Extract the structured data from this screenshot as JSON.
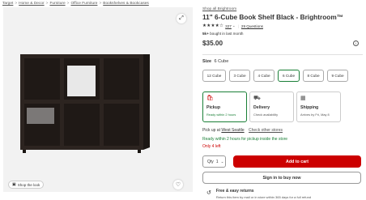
{
  "breadcrumb": [
    "Target",
    "Home & Decor",
    "Furniture",
    "Office Furniture",
    "Bookshelves & Bookcases"
  ],
  "breadcrumb_separator": ">",
  "image_panel": {
    "shop_the_look": "Shop the look"
  },
  "product": {
    "brand_link": "Shop all Brightroom",
    "title": "11\" 6-Cube Book Shelf Black - Brightroom™",
    "stars_filled": "★★★★",
    "stars_empty": "☆",
    "rating_count": "327",
    "questions": "29 Questions",
    "bought_bold": "5k+",
    "bought_text": "bought in last month",
    "price": "$35.00"
  },
  "size": {
    "label": "Size",
    "selected": "6 Cube",
    "options": [
      "12 Cube",
      "3 Cube",
      "4 Cube",
      "6 Cube",
      "8 Cube",
      "9 Cube"
    ]
  },
  "fulfillment": [
    {
      "title": "Pickup",
      "sub": "Ready within 2 hours"
    },
    {
      "title": "Delivery",
      "sub": "Check availability"
    },
    {
      "title": "Shipping",
      "sub": "Arrives by Fri, May 8"
    }
  ],
  "pickup": {
    "prefix": "Pick up at",
    "store": "West Seattle",
    "other": "Check other stores",
    "ready": "Ready within 2 hours for pickup inside the store",
    "stock": "Only 4 left"
  },
  "cart": {
    "qty_label": "Qty",
    "qty_value": "1",
    "add_to_cart": "Add to cart",
    "sign_in": "Sign in to buy now"
  },
  "returns": {
    "title": "Free & easy returns",
    "sub": "Return this item by mail or in store within 365 days for a full refund"
  },
  "colors": {
    "accent_red": "#cc0000",
    "selected_green": "#1a7f37"
  },
  "icons": [
    "expand-icon",
    "heart-icon",
    "info-icon",
    "pickup-bag-icon",
    "delivery-truck-icon",
    "shipping-box-icon",
    "returns-icon",
    "chevron-down-icon"
  ]
}
